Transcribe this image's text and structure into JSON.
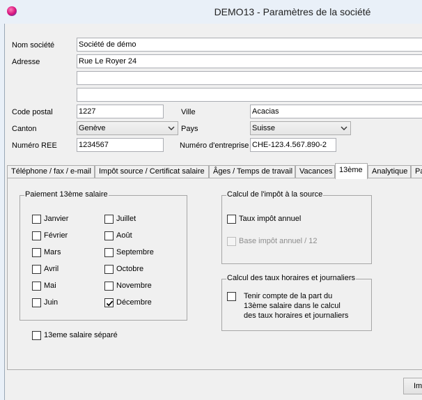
{
  "window": {
    "title": "DEMO13 - Paramètres de la société"
  },
  "form": {
    "nom_societe_label": "Nom société",
    "nom_societe_value": "Société de démo",
    "adresse_label": "Adresse",
    "adresse_line1": "Rue Le Royer 24",
    "adresse_line2": "",
    "adresse_line3": "",
    "code_postal_label": "Code postal",
    "code_postal_value": "1227",
    "ville_label": "Ville",
    "ville_value": "Acacias",
    "canton_label": "Canton",
    "canton_value": "Genève",
    "pays_label": "Pays",
    "pays_value": "Suisse",
    "numero_ree_label": "Numéro REE",
    "numero_ree_value": "1234567",
    "numero_entreprise_label": "Numéro d'entreprise",
    "numero_entreprise_value": "CHE-123.4.567.890-2"
  },
  "tabs": [
    {
      "label": "Téléphone / fax / e-mail"
    },
    {
      "label": "Impôt source / Certificat salaire"
    },
    {
      "label": "Âges / Temps de travail"
    },
    {
      "label": "Vacances"
    },
    {
      "label": "13ème",
      "active": true
    },
    {
      "label": "Analytique"
    },
    {
      "label": "Pa"
    }
  ],
  "paiement13": {
    "title": "Paiement 13ème salaire",
    "months": [
      {
        "label": "Janvier",
        "checked": false
      },
      {
        "label": "Février",
        "checked": false
      },
      {
        "label": "Mars",
        "checked": false
      },
      {
        "label": "Avril",
        "checked": false
      },
      {
        "label": "Mai",
        "checked": false
      },
      {
        "label": "Juin",
        "checked": false
      },
      {
        "label": "Juillet",
        "checked": false
      },
      {
        "label": "Août",
        "checked": false
      },
      {
        "label": "Septembre",
        "checked": false
      },
      {
        "label": "Octobre",
        "checked": false
      },
      {
        "label": "Novembre",
        "checked": false
      },
      {
        "label": "Décembre",
        "checked": true
      }
    ],
    "separe_label": "13eme salaire séparé",
    "separe_checked": false
  },
  "impot_source": {
    "title": "Calcul  de l'impôt à la source",
    "taux_label": "Taux impôt annuel",
    "taux_checked": false,
    "base_label": "Base impôt annuel / 12",
    "base_checked": false,
    "base_disabled": true
  },
  "taux_horaires": {
    "title": "Calcul des taux horaires et journaliers",
    "option_line1": "Tenir compte de la part du",
    "option_line2": "13ème salaire dans le calcul",
    "option_line3": "des taux horaires et journaliers",
    "option_checked": false
  },
  "footer": {
    "button_label": "Im"
  }
}
